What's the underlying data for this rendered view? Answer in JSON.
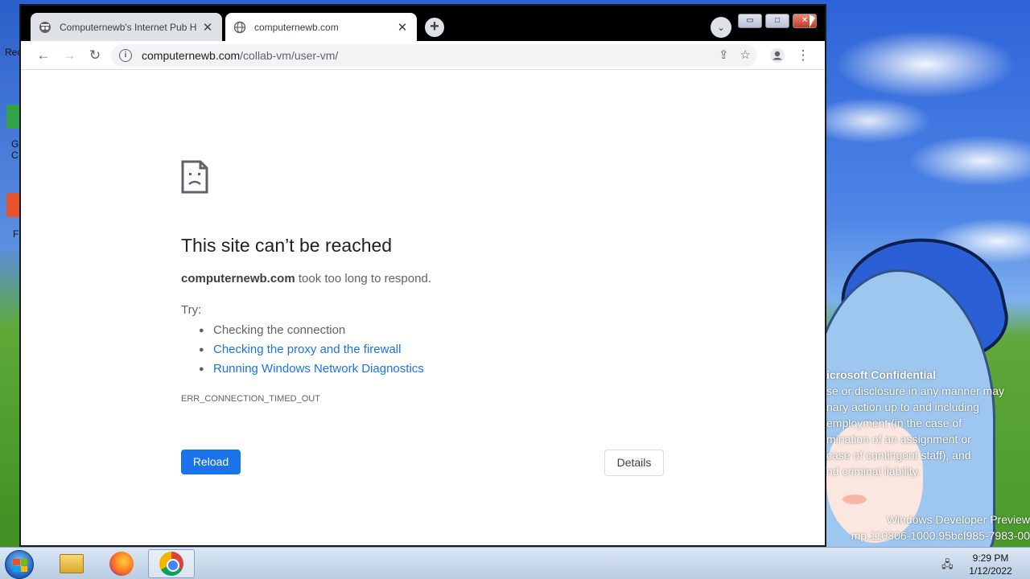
{
  "browser": {
    "tabs": [
      {
        "title": "Computernewb's Internet Pub H",
        "icon": "incognito-icon",
        "active": false
      },
      {
        "title": "computernewb.com",
        "icon": "globe-icon",
        "active": true
      }
    ],
    "url": {
      "host": "computernewb.com",
      "path": "/collab-vm/user-vm/"
    }
  },
  "error_page": {
    "title": "This site can’t be reached",
    "host": "computernewb.com",
    "message": " took too long to respond.",
    "try_label": "Try:",
    "suggestions": [
      {
        "text": "Checking the connection",
        "link": false
      },
      {
        "text": "Checking the proxy and the firewall",
        "link": true
      },
      {
        "text": "Running Windows Network Diagnostics",
        "link": true
      }
    ],
    "error_code": "ERR_CONNECTION_TIMED_OUT",
    "reload_label": "Reload",
    "details_label": "Details"
  },
  "desktop": {
    "left_labels": [
      "Rec",
      "G",
      "C",
      "F"
    ],
    "watermark": {
      "title": "icrosoft Confidential",
      "lines": [
        "se or disclosure in any manner may",
        "nary action up to and including",
        "employment (in the case of",
        "mination of an assignment or",
        " case of contingent staff), and",
        "nd criminal liability."
      ],
      "build_line1": "Windows Developer Preview",
      "build_line2": "mp.110806-1000.95bcf985-7983-00"
    }
  },
  "taskbar": {
    "time": "9:29 PM",
    "date": "1/12/2022"
  },
  "colors": {
    "accent": "#1a73e8",
    "link": "#1a73e8",
    "text_primary": "#202124",
    "text_secondary": "#5f6368"
  }
}
